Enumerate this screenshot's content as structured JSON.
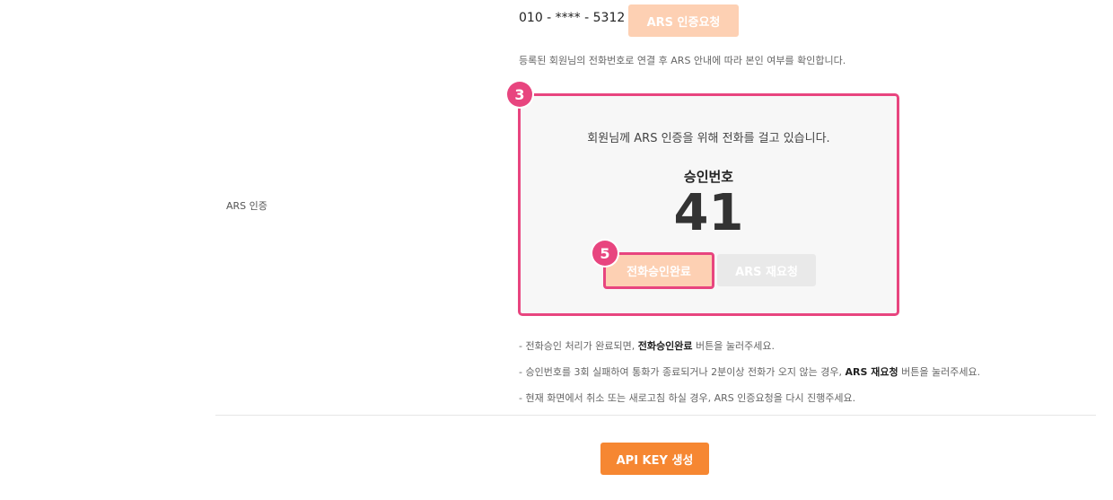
{
  "phone": {
    "number": "010 - **** - 5312",
    "ars_request_label": "ARS 인증요청",
    "description": "등록된 회원님의 전화번호로 연결 후 ARS 안내에 따라 본인 여부를 확인합니다."
  },
  "row": {
    "label": "ARS 인증"
  },
  "panel": {
    "calling_text": "회원님께 ARS 인증을 위해 전화를 걸고 있습니다.",
    "approval_label": "승인번호",
    "approval_number": "41",
    "complete_label": "전화승인완료",
    "retry_label": "ARS 재요청"
  },
  "annotations": {
    "badge_a": "3",
    "badge_b": "5",
    "color": "#e8457f"
  },
  "notes": {
    "n1_pre": "- 전화승인 처리가 완료되면, ",
    "n1_bold": "전화승인완료",
    "n1_post": " 버튼을 눌러주세요.",
    "n2_pre": "- 승인번호를 3회 실패하여 통화가 종료되거나 2분이상 전화가 오지 않는 경우, ",
    "n2_bold": "ARS 재요청",
    "n2_post": " 버튼을 눌러주세요.",
    "n3": "- 현재 화면에서 취소 또는 새로고침 하실 경우, ARS 인증요청을 다시 진행주세요."
  },
  "footer": {
    "api_key_label": "API KEY 생성"
  },
  "colors": {
    "accent": "#f68732",
    "accent_light": "#fdd0b3",
    "disabled": "#e9e9e9"
  }
}
